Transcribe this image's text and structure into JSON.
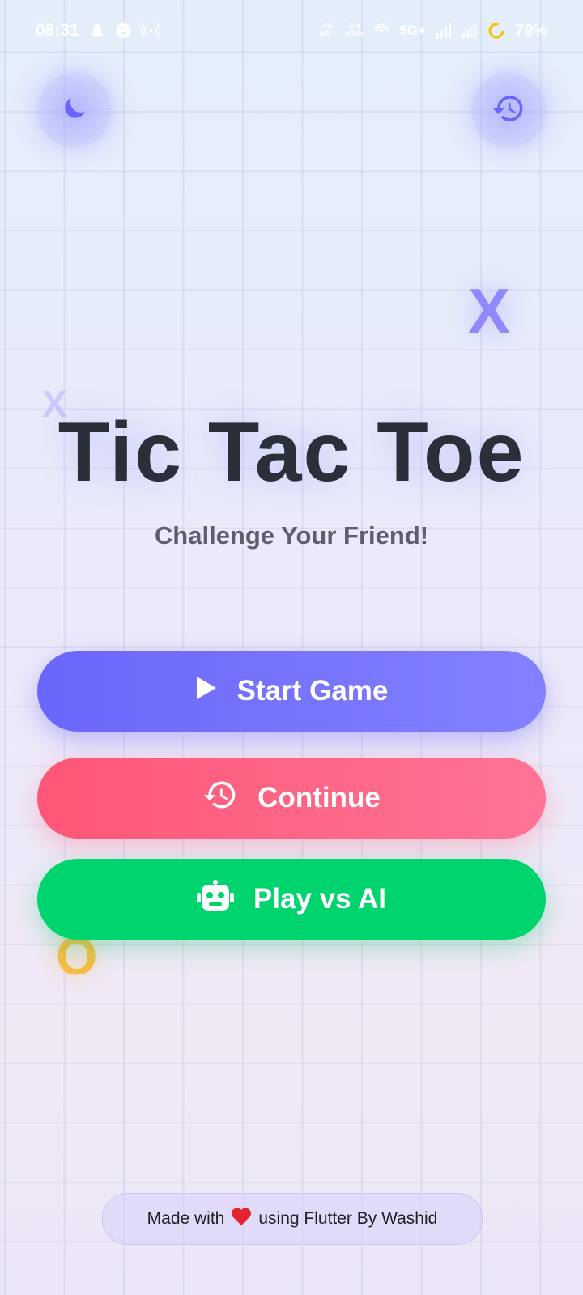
{
  "status_bar": {
    "time": "08:31",
    "network_top": "Vo",
    "network_bottom": "NR1",
    "speed_value": "3.5",
    "speed_unit": "KB/s",
    "network_type": "5G+",
    "battery": "79%"
  },
  "top_buttons": {
    "theme_icon": "moon-icon",
    "history_icon": "history-icon"
  },
  "decorations": {
    "big_x": "X",
    "small_x": "X",
    "o_mark": "O"
  },
  "main": {
    "title": "Tic Tac Toe",
    "subtitle": "Challenge Your Friend!"
  },
  "buttons": {
    "start_label": "Start Game",
    "continue_label": "Continue",
    "ai_label": "Play vs AI"
  },
  "footer": {
    "prefix": "Made with",
    "suffix": "using Flutter By Washid"
  },
  "colors": {
    "start": "#6d69fb",
    "continue": "#ff5c7e",
    "ai": "#00d46e",
    "accent": "#6f6bfb"
  }
}
